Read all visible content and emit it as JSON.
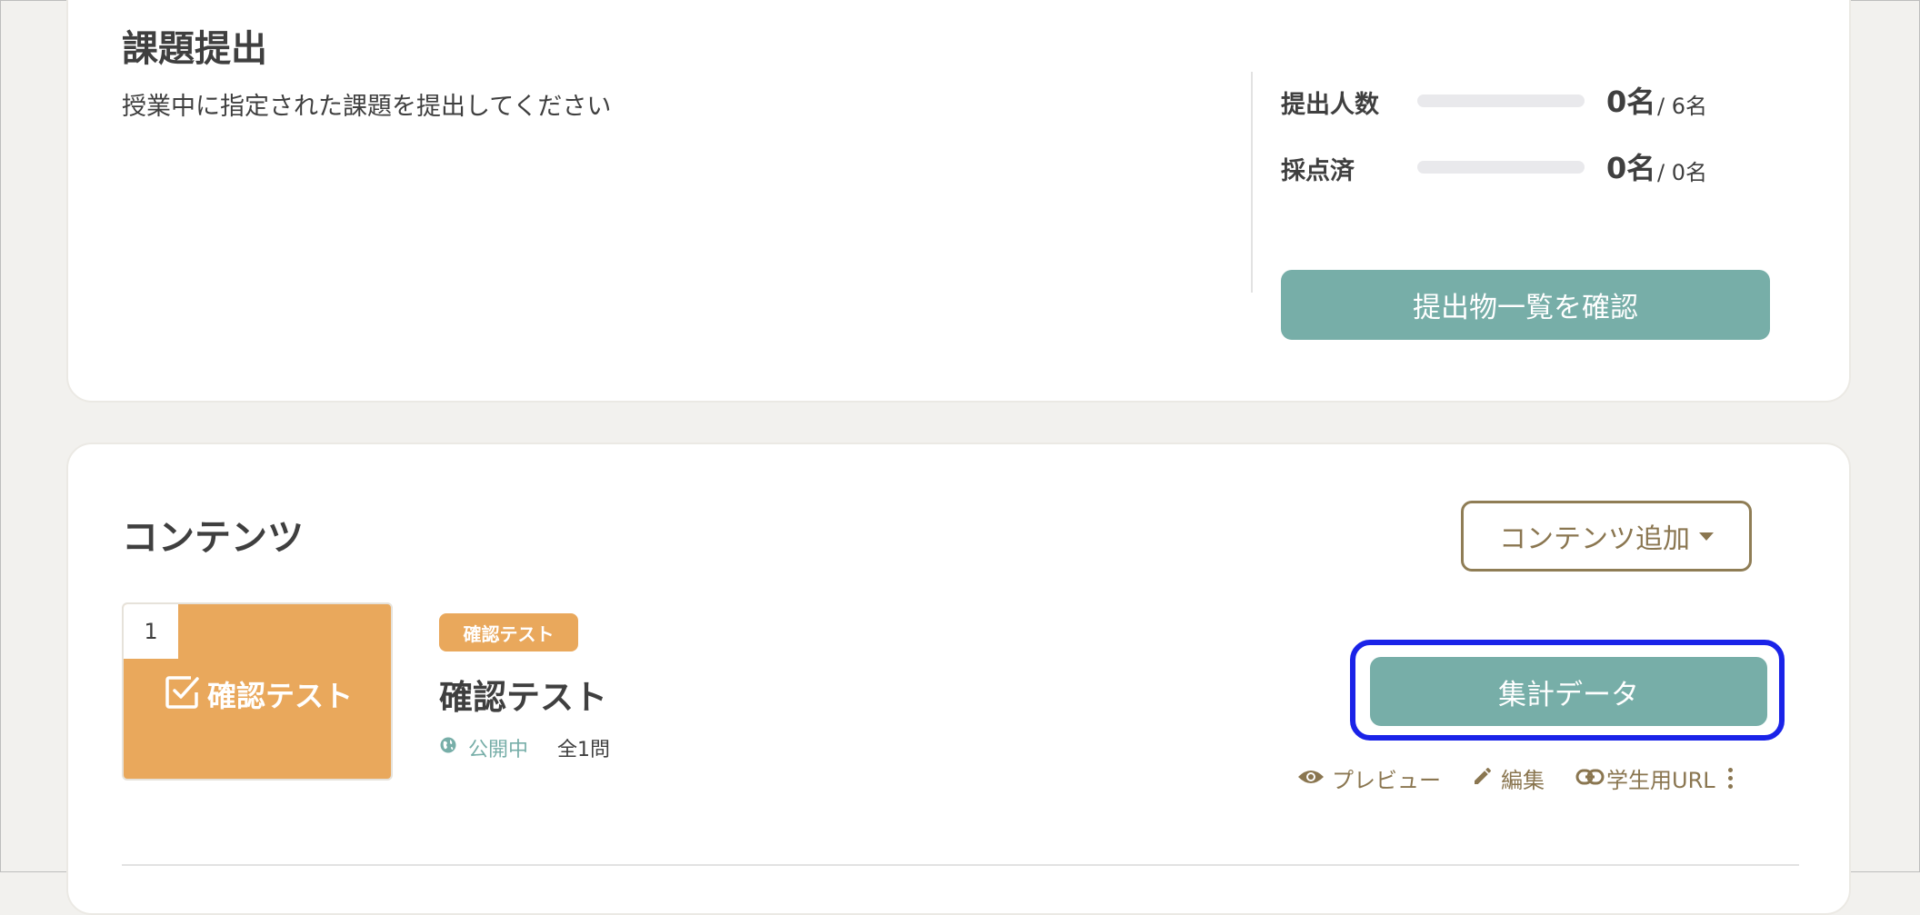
{
  "assignment": {
    "title": "課題提出",
    "description": "授業中に指定された課題を提出してください",
    "submitted": {
      "label": "提出人数",
      "count": "0名",
      "total": "/ 6名",
      "progress": 0
    },
    "graded": {
      "label": "採点済",
      "count": "0名",
      "total": "/ 0名",
      "progress": 0
    },
    "view_button_label": "提出物一覧を確認"
  },
  "contents": {
    "title": "コンテンツ",
    "add_button_label": "コンテンツ追加",
    "items": [
      {
        "number": "1",
        "thumb_label": "確認テスト",
        "type_badge": "確認テスト",
        "name": "確認テスト",
        "status": "公開中",
        "question_count": "全1問",
        "aggregate_button_label": "集計データ",
        "actions": {
          "preview": "プレビュー",
          "edit": "編集",
          "student_url": "学生用URL"
        }
      }
    ]
  },
  "icons": {
    "status": "globe-icon",
    "preview": "eye-icon",
    "edit": "pencil-icon",
    "student_url": "link-icon",
    "more": "more-vertical-icon",
    "thumb": "checkbox-icon",
    "add_caret": "caret-down-icon"
  },
  "colors": {
    "accent_teal": "#77aea8",
    "thumb_orange": "#e9a85c",
    "action_brown": "#8a7650",
    "highlight_blue": "#1a23e8",
    "background": "#f2f1ee"
  }
}
